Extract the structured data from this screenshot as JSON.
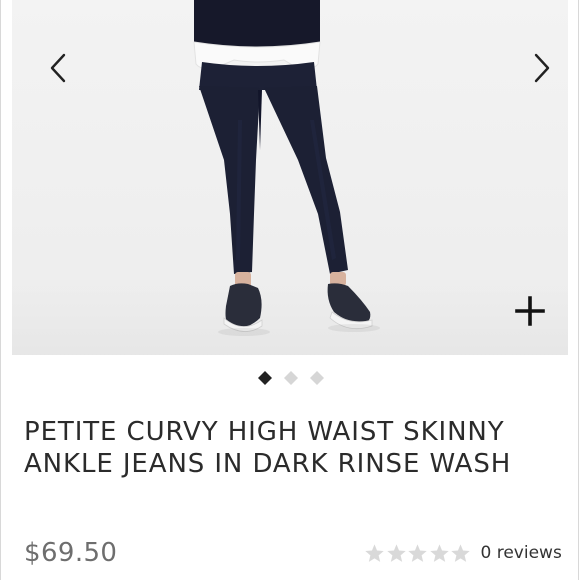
{
  "carousel": {
    "prev_icon": "chevron-left-icon",
    "next_icon": "chevron-right-icon",
    "zoom_icon": "plus-icon",
    "slide_count": 3,
    "active_slide": 1
  },
  "product": {
    "title": "PETITE CURVY HIGH WAIST SKINNY ANKLE JEANS IN DARK RINSE WASH",
    "price": "$69.50",
    "rating": 0,
    "rating_max": 5,
    "reviews_label": "0 reviews"
  },
  "colors": {
    "dot_active": "#222222",
    "dot_inactive": "#d6d6d6",
    "star_empty": "#d9d9d9",
    "price_text": "#6e6e6e",
    "title_text": "#2b2b2b"
  }
}
